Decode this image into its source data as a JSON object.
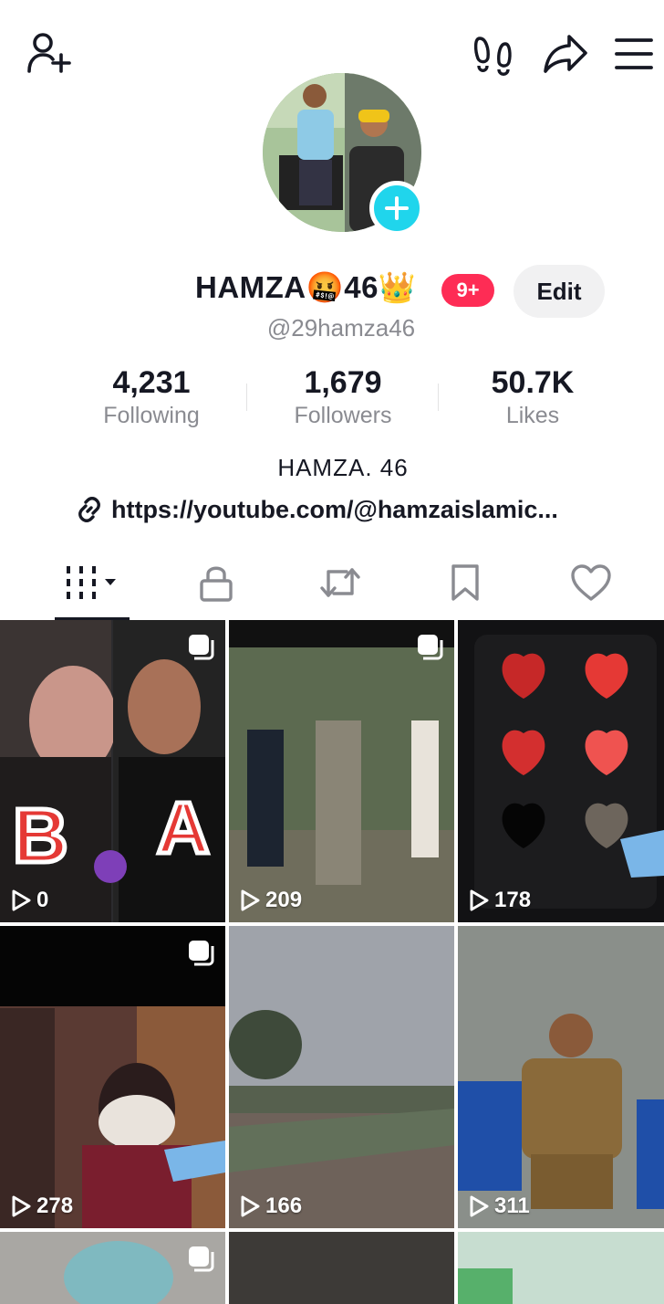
{
  "profile": {
    "name": "HAMZA🤬46👑",
    "notification_badge": "9+",
    "edit_label": "Edit",
    "handle": "@29hamza46",
    "bio": "HAMZA. 46",
    "link": "https://youtube.com/@hamzaislamic..."
  },
  "stats": {
    "following": {
      "value": "4,231",
      "label": "Following"
    },
    "followers": {
      "value": "1,679",
      "label": "Followers"
    },
    "likes": {
      "value": "50.7K",
      "label": "Likes"
    }
  },
  "tabs": [
    "videos",
    "private",
    "reposts",
    "favorites",
    "liked"
  ],
  "videos": [
    {
      "views": "0",
      "bg": "#2b2b2e"
    },
    {
      "views": "209",
      "bg": "#5c6a50"
    },
    {
      "views": "178",
      "bg": "#121214"
    },
    {
      "views": "278",
      "bg": "#5a3a33"
    },
    {
      "views": "166",
      "bg": "#8d9299"
    },
    {
      "views": "311",
      "bg": "#8a8f8a"
    },
    {
      "views": "",
      "bg": "#a9a7a3"
    },
    {
      "views": "",
      "bg": "#3d3a37"
    },
    {
      "views": "",
      "bg": "#c7ddd0"
    }
  ],
  "colors": {
    "accent": "#fe2c55",
    "plus": "#20d5ec",
    "text": "#161823",
    "muted": "#8a8b91"
  }
}
